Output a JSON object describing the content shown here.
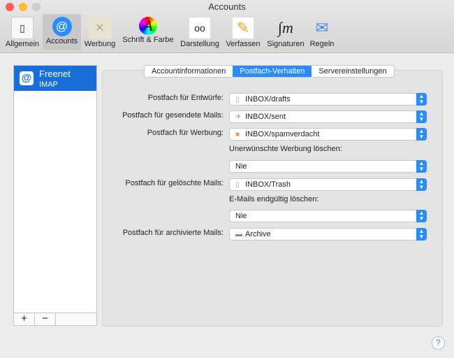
{
  "window": {
    "title": "Accounts"
  },
  "toolbar": [
    {
      "label": "Allgemein",
      "icon": "switch-icon"
    },
    {
      "label": "Accounts",
      "icon": "at-icon"
    },
    {
      "label": "Werbung",
      "icon": "trash-junk-icon"
    },
    {
      "label": "Schrift & Farbe",
      "icon": "font-color-icon"
    },
    {
      "label": "Darstellung",
      "icon": "glasses-icon"
    },
    {
      "label": "Verfassen",
      "icon": "pencil-icon"
    },
    {
      "label": "Signaturen",
      "icon": "signature-icon"
    },
    {
      "label": "Regeln",
      "icon": "rules-icon"
    }
  ],
  "accounts": [
    {
      "name": "Freenet",
      "type": "IMAP"
    }
  ],
  "sidebar_buttons": {
    "add": "+",
    "remove": "−"
  },
  "tabs": [
    "Accountinformationen",
    "Postfach-Verhalten",
    "Servereinstellungen"
  ],
  "form": {
    "drafts_label": "Postfach für Entwürfe:",
    "drafts": "INBOX/drafts",
    "sent_label": "Postfach für gesendete Mails:",
    "sent": "INBOX/sent",
    "junk_label": "Postfach für Werbung:",
    "junk": "INBOX/spamverdacht",
    "junk_delete_label": "Unerwünschte Werbung löschen:",
    "junk_delete": "Nie",
    "trash_label": "Postfach für gelöschte Mails:",
    "trash": "INBOX/Trash",
    "trash_delete_label": "E-Mails endgültig löschen:",
    "trash_delete": "Nie",
    "archive_label": "Postfach für archivierte Mails:",
    "archive": "Archive"
  },
  "help": "?"
}
